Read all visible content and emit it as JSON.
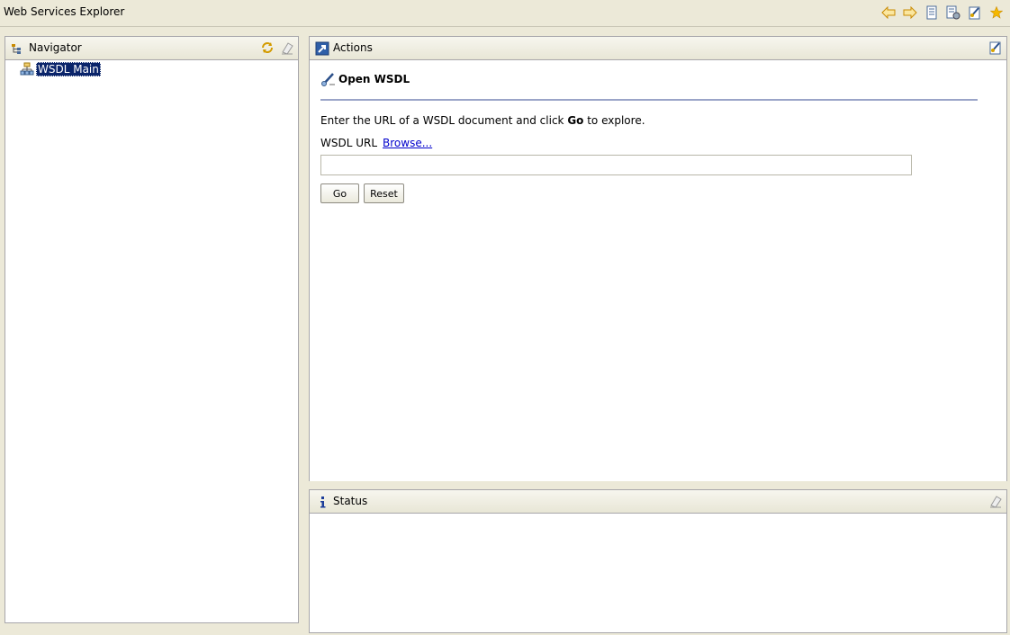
{
  "window": {
    "title": "Web Services Explorer"
  },
  "toolbar": {
    "items": [
      {
        "icon": "back-arrow-icon"
      },
      {
        "icon": "forward-arrow-icon"
      },
      {
        "icon": "document-icon"
      },
      {
        "icon": "document-gear-icon"
      },
      {
        "icon": "wsdl-page-icon"
      },
      {
        "icon": "favorites-star-icon"
      }
    ]
  },
  "navigator": {
    "title": "Navigator",
    "tree": [
      {
        "label": "WSDL Main",
        "selected": true
      }
    ]
  },
  "actions": {
    "title": "Actions",
    "form": {
      "heading": "Open WSDL",
      "instruction_prefix": "Enter the URL of a WSDL document and click ",
      "instruction_bold": "Go",
      "instruction_suffix": " to explore.",
      "url_label": "WSDL URL",
      "browse_link": "Browse...",
      "url_value": "",
      "go_label": "Go",
      "reset_label": "Reset"
    }
  },
  "status": {
    "title": "Status"
  },
  "colors": {
    "background": "#ece9d8",
    "selection": "#0a246a",
    "link": "#0000cc",
    "rule": "#9aa4c8",
    "accent_orange": "#e8a317"
  }
}
